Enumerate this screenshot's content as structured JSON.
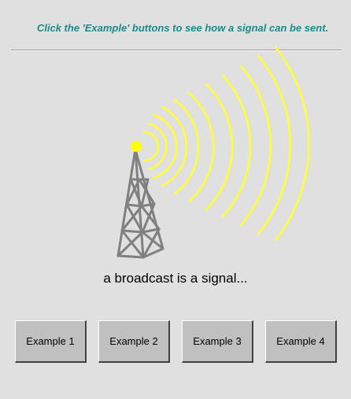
{
  "instruction_text": "Click the 'Example' buttons to see how a signal can be sent.",
  "caption_text": "a broadcast is a signal...",
  "buttons": [
    {
      "label": "Example 1"
    },
    {
      "label": "Example 2"
    },
    {
      "label": "Example 3"
    },
    {
      "label": "Example 4"
    }
  ],
  "colors": {
    "background": "#e0e0e0",
    "instruction_text": "#1a8a8a",
    "signal_waves": "#ffff33",
    "tower": "#808080",
    "antenna_tip": "#ffff00",
    "button_face": "#c0c0c0"
  },
  "icons": {
    "tower": "broadcast-tower-icon",
    "antenna_tip": "antenna-tip-icon",
    "waves": "signal-waves-icon"
  }
}
